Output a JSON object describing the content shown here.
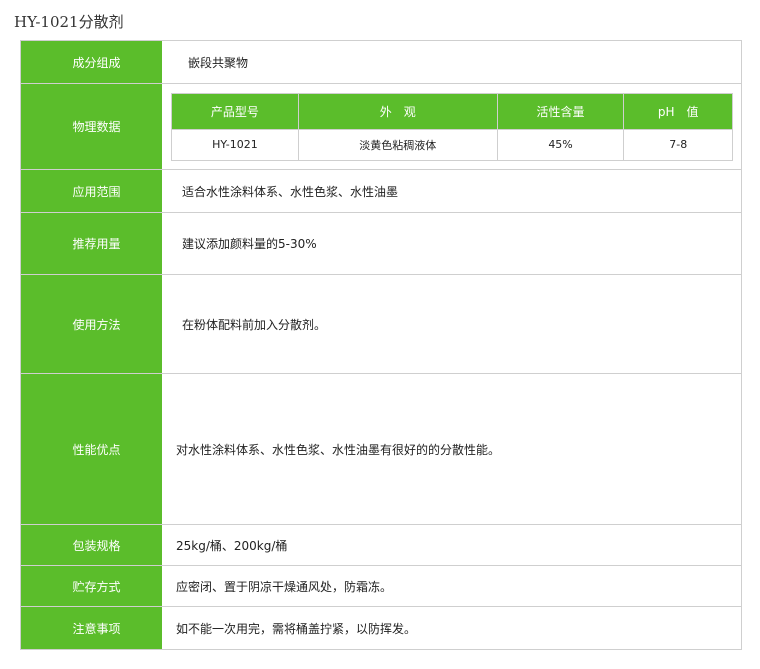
{
  "page_title": "HY-1021分散剂",
  "rows": [
    {
      "label": "成分组成",
      "value": "嵌段共聚物"
    },
    {
      "label": "物理数据"
    },
    {
      "label": "应用范围",
      "value": "适合水性涂料体系、水性色浆、水性油墨"
    },
    {
      "label": "推荐用量",
      "value": "建议添加颜料量的5-30%"
    },
    {
      "label": "使用方法",
      "value": "在粉体配料前加入分散剂。"
    },
    {
      "label": "性能优点",
      "value": "对水性涂料体系、水性色浆、水性油墨有很好的的分散性能。"
    },
    {
      "label": "包装规格",
      "value": "25kg/桶、200kg/桶"
    },
    {
      "label": "贮存方式",
      "value": "应密闭、置于阴凉干燥通风处，防霜冻。"
    },
    {
      "label": "注意事项",
      "value": "如不能一次用完，需将桶盖拧紧，以防挥发。"
    }
  ],
  "physical": {
    "headers": [
      "产品型号",
      "外　观",
      "活性含量",
      "pH　值"
    ],
    "values": [
      "HY-1021",
      "淡黄色粘稠液体",
      "45%",
      "7-8"
    ]
  }
}
